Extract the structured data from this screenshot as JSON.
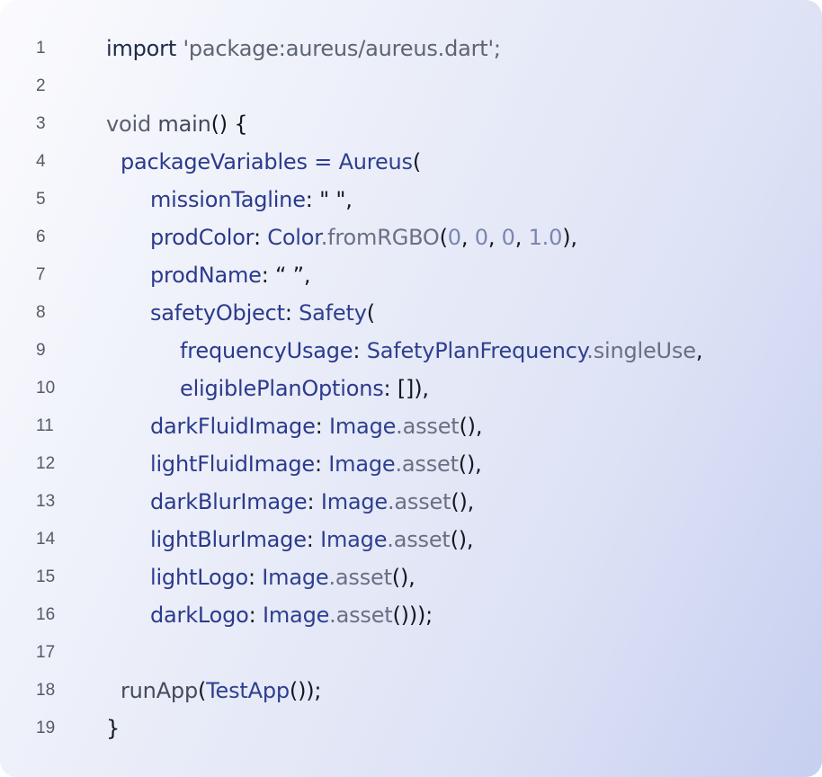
{
  "code_view": {
    "lines": [
      {
        "number": "1",
        "indent": 0,
        "tokens": [
          {
            "t": "import ",
            "k": "kw"
          },
          {
            "t": "'package:aureus/aureus.dart'",
            "k": "str"
          },
          {
            "t": ";",
            "k": "str"
          }
        ]
      },
      {
        "number": "2",
        "indent": 0,
        "tokens": []
      },
      {
        "number": "3",
        "indent": 0,
        "tokens": [
          {
            "t": "void ",
            "k": "kwg"
          },
          {
            "t": "main",
            "k": "fn"
          },
          {
            "t": "() {",
            "k": "p"
          }
        ]
      },
      {
        "number": "4",
        "indent": 1,
        "tokens": [
          {
            "t": "packageVariables",
            "k": "prop"
          },
          {
            "t": " = ",
            "k": "ref"
          },
          {
            "t": "Aureus",
            "k": "class"
          },
          {
            "t": "(",
            "k": "p"
          }
        ]
      },
      {
        "number": "5",
        "indent": 2,
        "tokens": [
          {
            "t": "missionTagline",
            "k": "prop"
          },
          {
            "t": ": \" \",",
            "k": "p"
          }
        ]
      },
      {
        "number": "6",
        "indent": 2,
        "tokens": [
          {
            "t": "prodColor",
            "k": "prop"
          },
          {
            "t": ": ",
            "k": "p"
          },
          {
            "t": "Color",
            "k": "class"
          },
          {
            "t": ".fromRGBO",
            "k": "meth"
          },
          {
            "t": "(",
            "k": "p"
          },
          {
            "t": "0",
            "k": "num"
          },
          {
            "t": ", ",
            "k": "p"
          },
          {
            "t": "0",
            "k": "num"
          },
          {
            "t": ", ",
            "k": "p"
          },
          {
            "t": "0",
            "k": "num"
          },
          {
            "t": ", ",
            "k": "p"
          },
          {
            "t": "1.0",
            "k": "num"
          },
          {
            "t": "),",
            "k": "p"
          }
        ]
      },
      {
        "number": "7",
        "indent": 2,
        "tokens": [
          {
            "t": "prodName",
            "k": "prop"
          },
          {
            "t": ": “ ”,",
            "k": "p"
          }
        ]
      },
      {
        "number": "8",
        "indent": 2,
        "tokens": [
          {
            "t": "safetyObject",
            "k": "prop"
          },
          {
            "t": ": ",
            "k": "p"
          },
          {
            "t": "Safety",
            "k": "class"
          },
          {
            "t": "(",
            "k": "p"
          }
        ]
      },
      {
        "number": "9",
        "indent": 3,
        "tokens": [
          {
            "t": "frequencyUsage",
            "k": "prop"
          },
          {
            "t": ": ",
            "k": "p"
          },
          {
            "t": "SafetyPlanFrequency",
            "k": "class"
          },
          {
            "t": ".singleUse",
            "k": "meth"
          },
          {
            "t": ",",
            "k": "p"
          }
        ]
      },
      {
        "number": "10",
        "indent": 3,
        "tokens": [
          {
            "t": "eligiblePlanOptions",
            "k": "prop"
          },
          {
            "t": ": []),",
            "k": "p"
          }
        ]
      },
      {
        "number": "11",
        "indent": 2,
        "tokens": [
          {
            "t": "darkFluidImage",
            "k": "prop"
          },
          {
            "t": ": ",
            "k": "p"
          },
          {
            "t": "Image",
            "k": "class"
          },
          {
            "t": ".asset",
            "k": "meth"
          },
          {
            "t": "(),",
            "k": "p"
          }
        ]
      },
      {
        "number": "12",
        "indent": 2,
        "tokens": [
          {
            "t": "lightFluidImage",
            "k": "prop"
          },
          {
            "t": ": ",
            "k": "p"
          },
          {
            "t": "Image",
            "k": "class"
          },
          {
            "t": ".asset",
            "k": "meth"
          },
          {
            "t": "(),",
            "k": "p"
          }
        ]
      },
      {
        "number": "13",
        "indent": 2,
        "tokens": [
          {
            "t": "darkBlurImage",
            "k": "prop"
          },
          {
            "t": ": ",
            "k": "p"
          },
          {
            "t": "Image",
            "k": "class"
          },
          {
            "t": ".asset",
            "k": "meth"
          },
          {
            "t": "(),",
            "k": "p"
          }
        ]
      },
      {
        "number": "14",
        "indent": 2,
        "tokens": [
          {
            "t": "lightBlurImage",
            "k": "prop"
          },
          {
            "t": ": ",
            "k": "p"
          },
          {
            "t": "Image",
            "k": "class"
          },
          {
            "t": ".asset",
            "k": "meth"
          },
          {
            "t": "(),",
            "k": "p"
          }
        ]
      },
      {
        "number": "15",
        "indent": 2,
        "tokens": [
          {
            "t": "lightLogo",
            "k": "prop"
          },
          {
            "t": ": ",
            "k": "p"
          },
          {
            "t": "Image",
            "k": "class"
          },
          {
            "t": ".asset",
            "k": "meth"
          },
          {
            "t": "(),",
            "k": "p"
          }
        ]
      },
      {
        "number": "16",
        "indent": 2,
        "tokens": [
          {
            "t": "darkLogo",
            "k": "prop"
          },
          {
            "t": ": ",
            "k": "p"
          },
          {
            "t": "Image",
            "k": "class"
          },
          {
            "t": ".asset",
            "k": "meth"
          },
          {
            "t": "()));",
            "k": "p"
          }
        ]
      },
      {
        "number": "17",
        "indent": 0,
        "tokens": []
      },
      {
        "number": "18",
        "indent": 1,
        "tokens": [
          {
            "t": "runApp",
            "k": "fn"
          },
          {
            "t": "(",
            "k": "p"
          },
          {
            "t": "TestApp",
            "k": "class"
          },
          {
            "t": "());",
            "k": "p"
          }
        ]
      },
      {
        "number": "19",
        "indent": 0,
        "tokens": [
          {
            "t": "}",
            "k": "p"
          }
        ]
      }
    ]
  },
  "colors": {
    "background_start": "#fbfbfe",
    "background_end": "#c7cff0",
    "line_number": "#555a66",
    "keyword": "#1e2a4a",
    "string": "#5d6472",
    "property": "#2b3a8c",
    "class_name": "#2f3f8f",
    "method": "#6a7084",
    "number": "#7a86b0",
    "punctuation": "#141820"
  }
}
